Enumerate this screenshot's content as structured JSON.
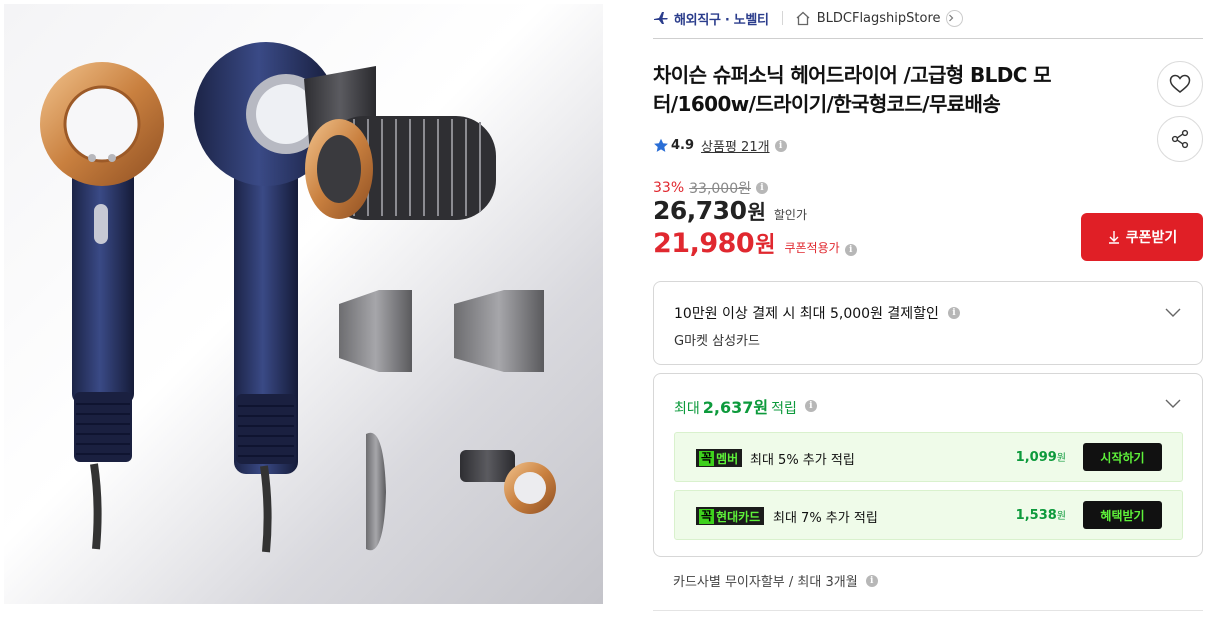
{
  "breadcrumb": {
    "overseas_label": "해외직구 · 노벨티",
    "store_name": "BLDCFlagshipStore"
  },
  "product": {
    "title": "차이슨 슈퍼소닉 헤어드라이어 /고급형 BLDC 모터/1600w/드라이기/한국형코드/무료배송",
    "image_alt": "hair dryer product image"
  },
  "rating": {
    "score": "4.9",
    "reviews_label": "상품평 21개"
  },
  "price": {
    "discount_rate": "33%",
    "original_price": "33,000원",
    "sale_price": "26,730",
    "sale_currency": "원",
    "sale_label": "할인가",
    "coupon_price": "21,980",
    "coupon_currency": "원",
    "coupon_label": "쿠폰적용가"
  },
  "actions": {
    "coupon_button": "쿠폰받기"
  },
  "payment_benefit": {
    "main": "10만원 이상 결제 시 최대 5,000원 결제할인",
    "sub": "G마켓 삼성카드"
  },
  "points": {
    "prefix": "최대",
    "amount": "2,637원",
    "suffix": "적립",
    "items": [
      {
        "badge_a": "꼭",
        "badge_b": "멤버",
        "text": "최대 5% 추가 적립",
        "value": "1,099",
        "unit": "원",
        "action": "시작하기"
      },
      {
        "badge_a": "꼭",
        "badge_b": "현대카드",
        "text": "최대 7% 추가 적립",
        "value": "1,538",
        "unit": "원",
        "action": "혜택받기"
      }
    ]
  },
  "installment": {
    "text": "카드사별 무이자할부 / 최대 3개월"
  },
  "colors": {
    "accent_red": "#e01f26",
    "points_green": "#0d9a3c",
    "brand_navy": "#2b3d8c"
  },
  "icons": {
    "plane": "plane-icon",
    "store": "store-home-icon",
    "heart": "heart-icon",
    "share": "share-icon",
    "star": "star-icon",
    "download": "download-arrow-icon",
    "chevron": "chevron-down-icon"
  }
}
